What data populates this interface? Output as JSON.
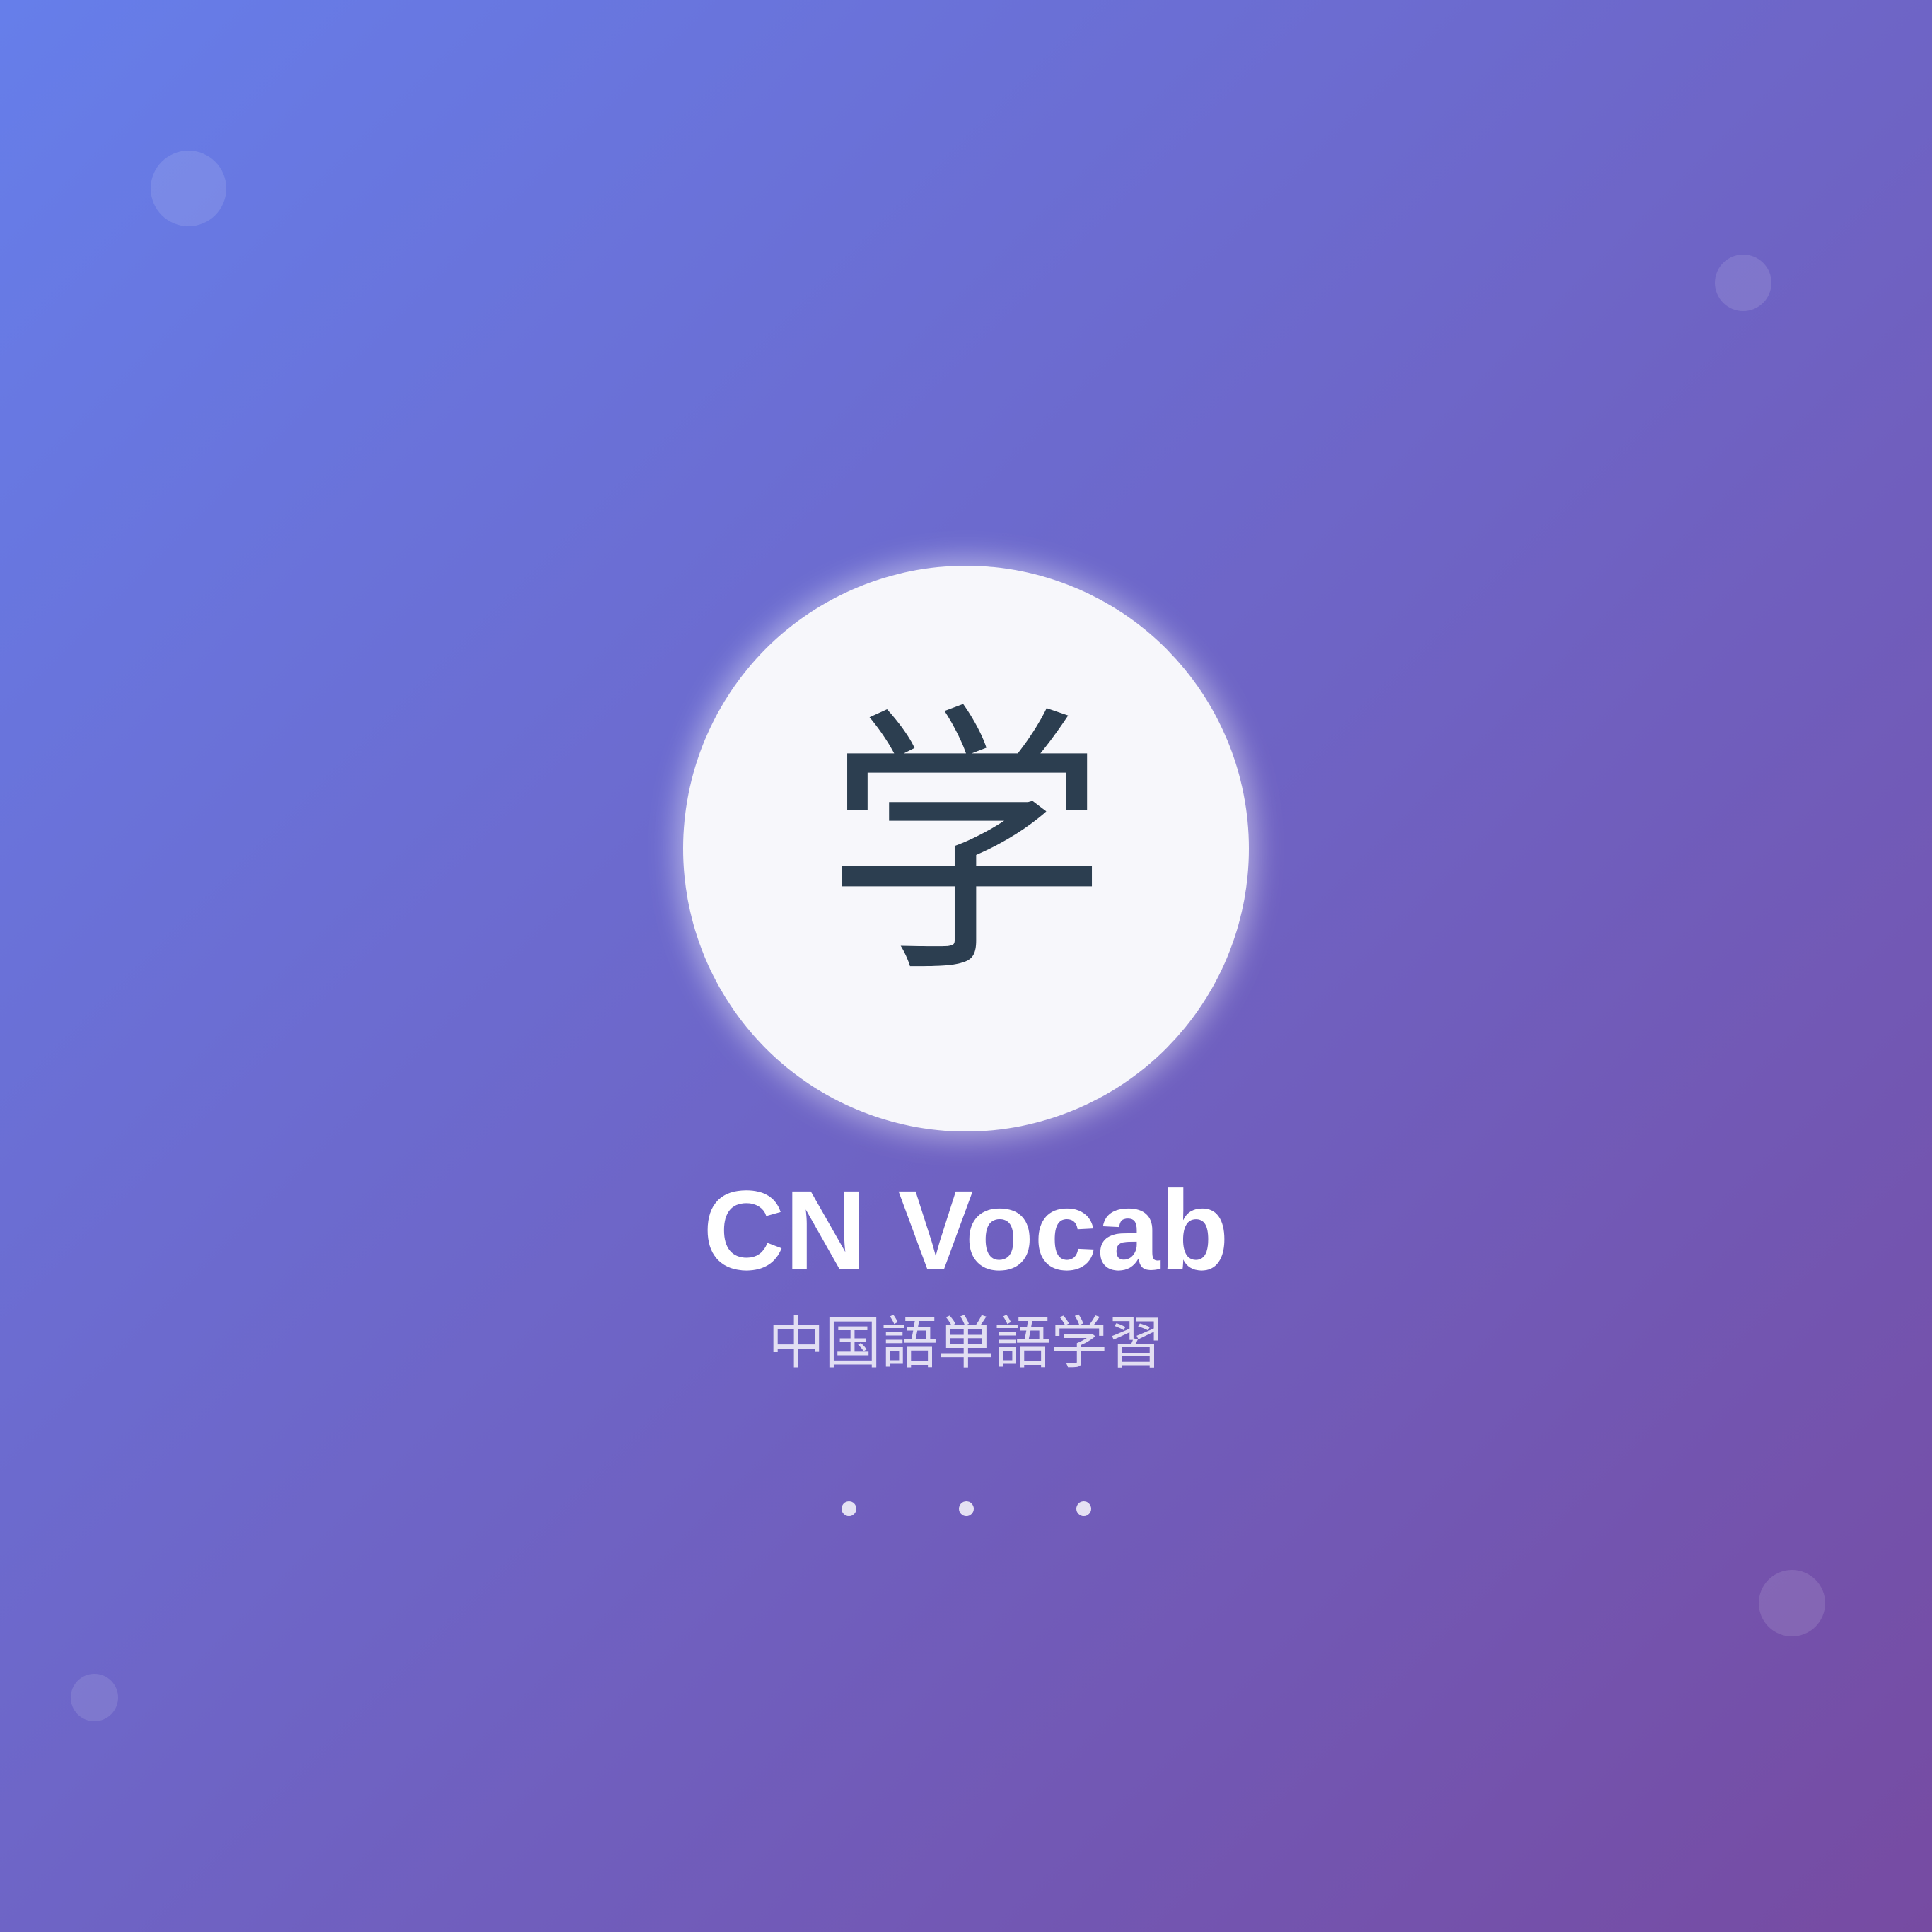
{
  "splash": {
    "logo_character": "学",
    "app_name": "CN Vocab",
    "tagline": "中国語単語学習"
  },
  "colors": {
    "background_start": "#667eea",
    "background_end": "#764ba2",
    "logo_background": "#f7f7fb",
    "logo_text": "#2c3e50",
    "title_text": "#ffffff"
  },
  "icons": {
    "loader": "loading-dots-icon"
  }
}
